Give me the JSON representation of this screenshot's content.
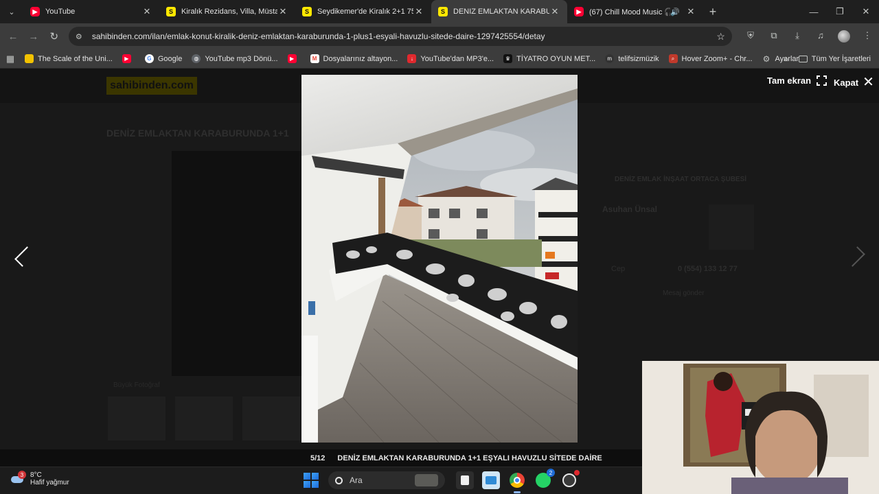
{
  "tabs": [
    {
      "title": "YouTube",
      "favicon": "youtube-icon",
      "active": false
    },
    {
      "title": "Kiralık Rezidans, Villa, Müstakil E",
      "favicon": "sahibinden-icon",
      "active": false
    },
    {
      "title": "Seydikemer'de Kiralık 2+1 75m²",
      "favicon": "sahibinden-icon",
      "active": false
    },
    {
      "title": "DENIZ EMLAKTAN KARABURUN",
      "favicon": "sahibinden-icon",
      "active": true
    },
    {
      "title": "(67) Chill Mood Music 🎧 –",
      "favicon": "youtube-icon",
      "active": false,
      "audio": true
    }
  ],
  "address": {
    "url": "sahibinden.com/ilan/emlak-konut-kiralik-deniz-emlaktan-karaburunda-1-plus1-esyali-havuzlu-sitede-daire-1297425554/detay"
  },
  "bookmarks": [
    {
      "label": "The Scale of the Uni...",
      "icon": "bookmark-yellow-icon",
      "color": "#f2c200"
    },
    {
      "label": "",
      "icon": "youtube-icon",
      "color": "#ff0033"
    },
    {
      "label": "Google",
      "icon": "google-icon",
      "color": "#4285f4"
    },
    {
      "label": "YouTube mp3 Dönü...",
      "icon": "globe-icon",
      "color": "#5f6368"
    },
    {
      "label": "",
      "icon": "youtube-icon",
      "color": "#ff0033"
    },
    {
      "label": "Dosyalarınız altayon...",
      "icon": "gmail-icon",
      "color": "#ea4335"
    },
    {
      "label": "YouTube'dan MP3'e...",
      "icon": "download-red-icon",
      "color": "#e0292e"
    },
    {
      "label": "TİYATRO OYUN MET...",
      "icon": "crown-icon",
      "color": "#222222"
    },
    {
      "label": "telifsizmüzik",
      "icon": "m-icon",
      "color": "#333333"
    },
    {
      "label": "Hover Zoom+ - Chr...",
      "icon": "hover-zoom-icon",
      "color": "#c0392b"
    },
    {
      "label": "Ayarlar",
      "icon": "gear-icon",
      "color": "#5f6368"
    }
  ],
  "bookmarks_all": "Tüm Yer İşaretleri",
  "background_page": {
    "logo": "sahibinden.com",
    "title": "DENİZ EMLAKTAN KARABURUNDA 1+1",
    "big_photo": "Büyük Fotoğraf",
    "store": "DENİZ EMLAK İNŞAAT ORTACA ŞUBESİ",
    "agent": "Asuhan Ünsal",
    "phone_label": "Cep",
    "phone": "0 (554) 133 12 77",
    "message": "Mesaj gönder"
  },
  "lightbox": {
    "fullscreen_label": "Tam ekran",
    "close_label": "Kapat",
    "counter": "5/12",
    "caption": "DENİZ EMLAKTAN KARABURUNDA 1+1 EŞYALI HAVUZLU SİTEDE DAİRE"
  },
  "taskbar": {
    "weather_badge": "3",
    "temperature": "8°C",
    "condition": "Hafif yağmur",
    "search_placeholder": "Ara",
    "whatsapp_count": "2"
  }
}
